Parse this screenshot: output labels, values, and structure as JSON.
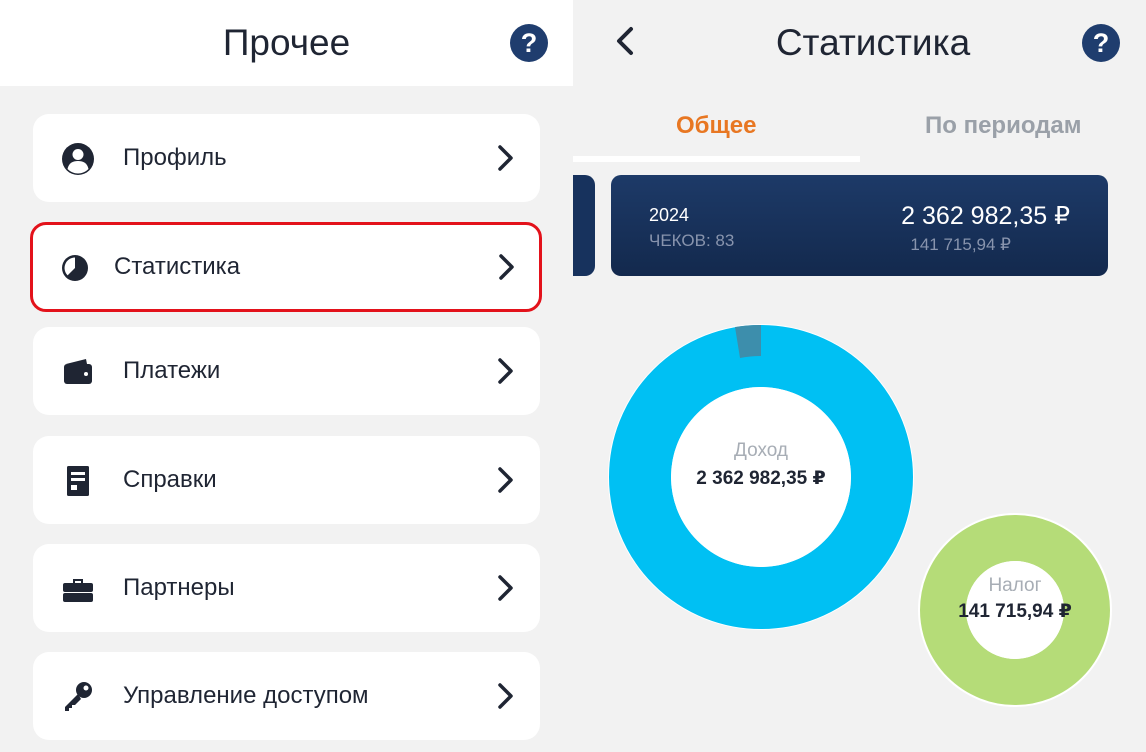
{
  "left_panel": {
    "title": "Прочее",
    "help_label": "?",
    "menu": [
      {
        "label": "Профиль",
        "icon": "user-icon"
      },
      {
        "label": "Статистика",
        "icon": "pie-chart-icon"
      },
      {
        "label": "Платежи",
        "icon": "wallet-icon"
      },
      {
        "label": "Справки",
        "icon": "document-icon"
      },
      {
        "label": "Партнеры",
        "icon": "briefcase-icon"
      },
      {
        "label": "Управление доступом",
        "icon": "key-icon"
      }
    ],
    "highlight_color": "#e3121b"
  },
  "right_panel": {
    "title": "Статистика",
    "help_label": "?",
    "tabs": [
      {
        "label": "Общее",
        "active": true
      },
      {
        "label": "По периодам",
        "active": false
      }
    ],
    "year_card": {
      "year": "2024",
      "checks": "ЧЕКОВ: 83",
      "amount": "2 362 982,35 ₽",
      "tax": "141 715,94 ₽"
    },
    "income_chart": {
      "caption": "Доход",
      "value": "2 362 982,35 ₽",
      "colors": {
        "main": "#00c0f3",
        "minor": "#3d8eac"
      }
    },
    "tax_chart": {
      "caption": "Налог",
      "value": "141 715,94 ₽",
      "color": "#b5dc78"
    }
  },
  "colors": {
    "accent_orange": "#e87722",
    "navy": "#1f3d6e"
  }
}
